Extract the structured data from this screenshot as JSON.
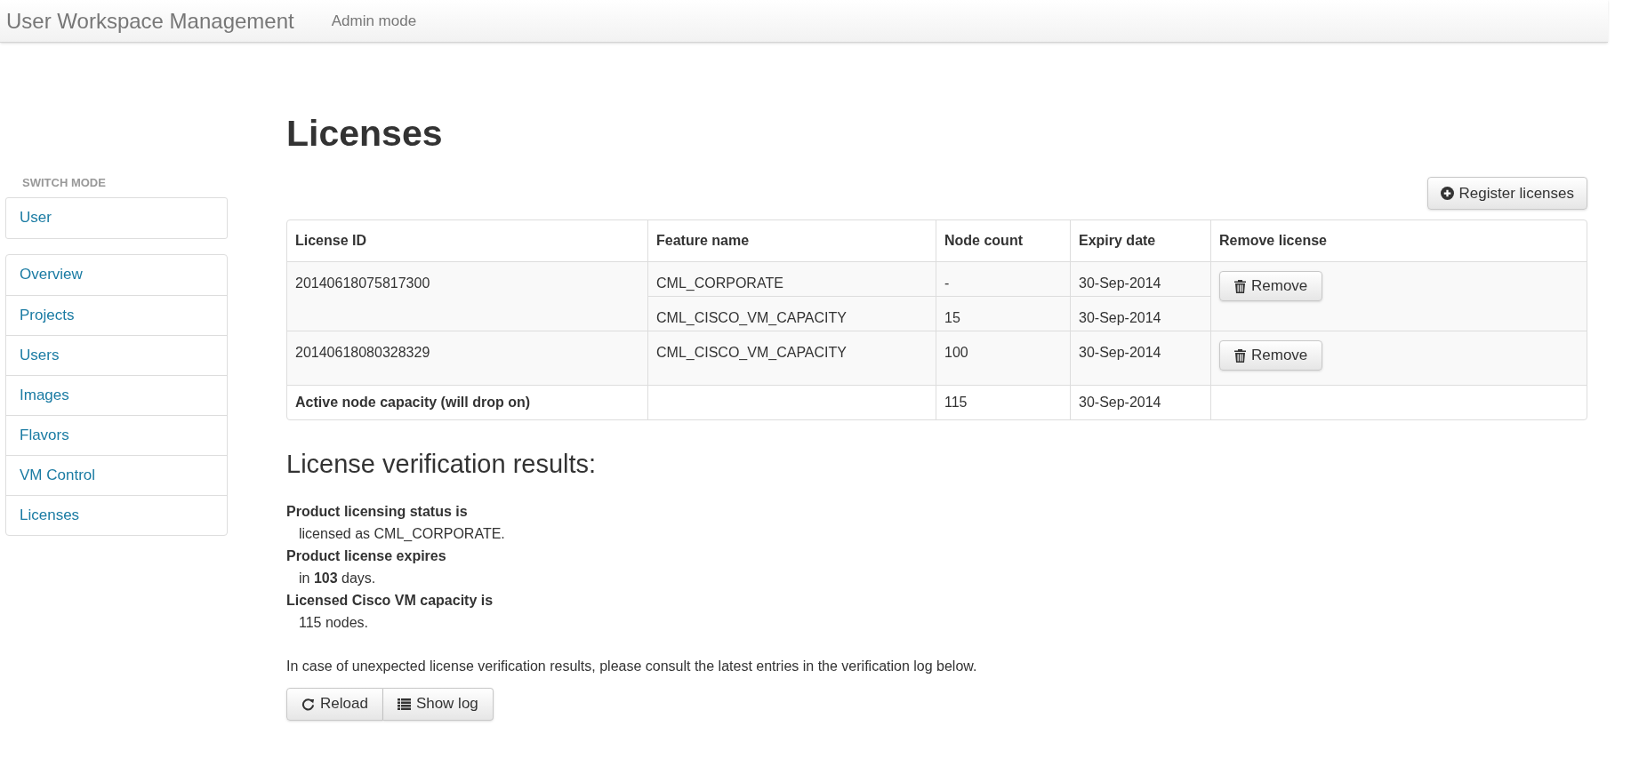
{
  "navbar": {
    "brand": "User Workspace Management",
    "mode": "Admin mode"
  },
  "sidebar": {
    "heading": "SWITCH MODE",
    "switch_items": [
      "User"
    ],
    "nav_items": [
      "Overview",
      "Projects",
      "Users",
      "Images",
      "Flavors",
      "VM Control",
      "Licenses"
    ]
  },
  "page_title": "Licenses",
  "register_button": "Register licenses",
  "table": {
    "columns": [
      "License ID",
      "Feature name",
      "Node count",
      "Expiry date",
      "Remove license"
    ],
    "licenses": [
      {
        "id": "20140618075817300",
        "remove_button": "Remove",
        "features": [
          {
            "name": "CML_CORPORATE",
            "node_count": "-",
            "expiry": "30-Sep-2014"
          },
          {
            "name": "CML_CISCO_VM_CAPACITY",
            "node_count": "15",
            "expiry": "30-Sep-2014"
          }
        ]
      },
      {
        "id": "20140618080328329",
        "remove_button": "Remove",
        "features": [
          {
            "name": "CML_CISCO_VM_CAPACITY",
            "node_count": "100",
            "expiry": "30-Sep-2014"
          }
        ]
      }
    ],
    "total": {
      "label": "Active node capacity (will drop on)",
      "node_count": "115",
      "expiry": "30-Sep-2014"
    }
  },
  "verification": {
    "heading": "License verification results:",
    "results": [
      {
        "label": "Product licensing status is",
        "value": "licensed as CML_CORPORATE."
      },
      {
        "label": "Product license expires",
        "value": "in **103** days."
      },
      {
        "label": "Licensed Cisco VM capacity is",
        "value": "115 nodes."
      }
    ],
    "note": "In case of unexpected license verification results, please consult the latest entries in the verification log below.",
    "buttons": [
      {
        "kind": "reload",
        "label": "Reload"
      },
      {
        "kind": "log",
        "label": "Show log"
      }
    ]
  }
}
